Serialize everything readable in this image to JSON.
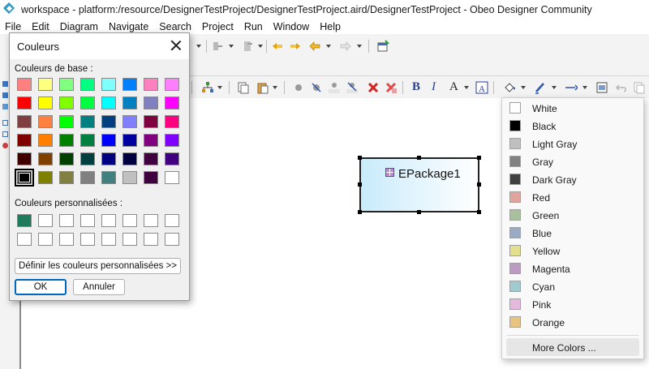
{
  "window": {
    "title": "workspace - platform:/resource/DesignerTestProject/DesignerTestProject.aird/DesignerTestProject - Obeo Designer Community"
  },
  "menubar": {
    "items": [
      "File",
      "Edit",
      "Diagram",
      "Navigate",
      "Search",
      "Project",
      "Run",
      "Window",
      "Help"
    ]
  },
  "toolbar2": {
    "bold_label": "B",
    "italic_label": "I",
    "font_color_label": "A"
  },
  "diagram": {
    "node_label": "EPackage1",
    "node_fill_colors": [
      "#c9ebfb",
      "#ffffff"
    ]
  },
  "color_dialog": {
    "title": "Couleurs",
    "basic_colors_label": "Couleurs de base :",
    "custom_colors_label": "Couleurs personnalisées :",
    "define_custom_button": "Définir les couleurs personnalisées >>",
    "ok_button": "OK",
    "cancel_button": "Annuler",
    "selected_basic_index": 40,
    "basic_colors": [
      "#ff8080",
      "#ffff80",
      "#80ff80",
      "#00ff80",
      "#80ffff",
      "#0080ff",
      "#ff80c0",
      "#ff80ff",
      "#ff0000",
      "#ffff00",
      "#80ff00",
      "#00ff40",
      "#00ffff",
      "#0080c0",
      "#8080c0",
      "#ff00ff",
      "#804040",
      "#ff8040",
      "#00ff00",
      "#008080",
      "#004080",
      "#8080ff",
      "#800040",
      "#ff0080",
      "#800000",
      "#ff8000",
      "#008000",
      "#008040",
      "#0000ff",
      "#0000a0",
      "#800080",
      "#8000ff",
      "#400000",
      "#804000",
      "#004000",
      "#004040",
      "#000080",
      "#000040",
      "#400040",
      "#400080",
      "#000000",
      "#808000",
      "#808040",
      "#808080",
      "#408080",
      "#c0c0c0",
      "#400040",
      "#ffffff"
    ],
    "custom_colors": [
      "#1e7b5c",
      "#ffffff",
      "#ffffff",
      "#ffffff",
      "#ffffff",
      "#ffffff",
      "#ffffff",
      "#ffffff",
      "#ffffff",
      "#ffffff",
      "#ffffff",
      "#ffffff",
      "#ffffff",
      "#ffffff",
      "#ffffff",
      "#ffffff"
    ]
  },
  "color_menu": {
    "items": [
      {
        "label": "White",
        "color": "#ffffff"
      },
      {
        "label": "Black",
        "color": "#000000"
      },
      {
        "label": "Light Gray",
        "color": "#c0c0c0"
      },
      {
        "label": "Gray",
        "color": "#808080"
      },
      {
        "label": "Dark Gray",
        "color": "#404040"
      },
      {
        "label": "Red",
        "color": "#e1a49b"
      },
      {
        "label": "Green",
        "color": "#a8c09c"
      },
      {
        "label": "Blue",
        "color": "#9aaac4"
      },
      {
        "label": "Yellow",
        "color": "#e2e08e"
      },
      {
        "label": "Magenta",
        "color": "#bc9ac4"
      },
      {
        "label": "Cyan",
        "color": "#9fcbd0"
      },
      {
        "label": "Pink",
        "color": "#e4b9e0"
      },
      {
        "label": "Orange",
        "color": "#e8c480"
      }
    ],
    "more_colors_label": "More Colors ..."
  }
}
